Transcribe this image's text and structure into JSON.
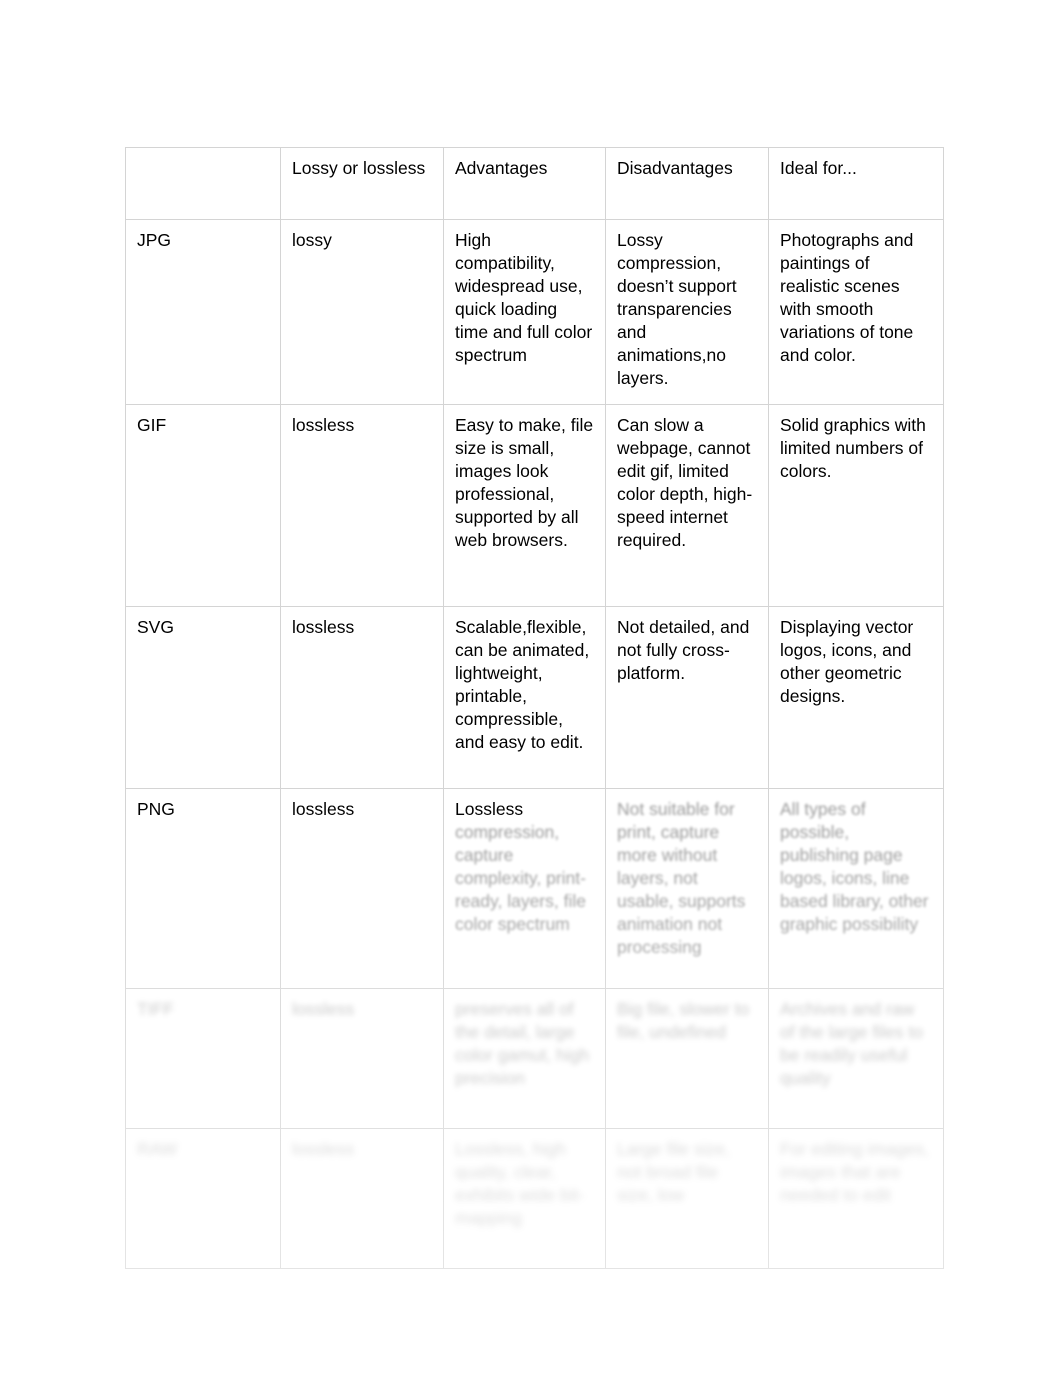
{
  "document": {
    "type": "comparison-table",
    "background_color": "#ffffff",
    "text_color": "#000000",
    "border_color": "#d4d4d4"
  },
  "table": {
    "columns": [
      {
        "key": "format",
        "header": ""
      },
      {
        "key": "lossy",
        "header": "Lossy or lossless"
      },
      {
        "key": "advantages",
        "header": "Advantages"
      },
      {
        "key": "disadvantages",
        "header": "Disadvantages"
      },
      {
        "key": "ideal",
        "header": "Ideal for..."
      }
    ],
    "rows": [
      {
        "legible": true,
        "blur": "none",
        "format": "JPG",
        "lossy": "lossy",
        "advantages": "High compatibility, widespread use, quick loading time and full color spectrum",
        "disadvantages": "Lossy compression, doesn’t support transparencies and animations,no layers.",
        "ideal": "Photographs and paintings of realistic scenes with smooth variations of tone and color."
      },
      {
        "legible": true,
        "blur": "none",
        "format": "GIF",
        "lossy": "lossless",
        "advantages": "Easy to make, file size is small, images look professional, supported by all web browsers.",
        "disadvantages": "Can slow a webpage, cannot edit gif, limited color depth, high-speed internet required.",
        "ideal": "Solid graphics with limited numbers of colors."
      },
      {
        "legible": true,
        "blur": "none",
        "format": "SVG",
        "lossy": "lossless",
        "advantages": "Scalable,flexible, can be animated, lightweight, printable, compressible, and easy to edit.",
        "disadvantages": "Not detailed, and not fully cross-platform.",
        "ideal": "Displaying vector logos, icons, and other geometric designs."
      },
      {
        "legible": "partial",
        "blur": "light",
        "format": "PNG",
        "lossy": "lossless",
        "advantages": "Lossless",
        "advantages_blurred": "compression, capture complexity, print-ready, layers, file color spectrum",
        "disadvantages_blurred": "Not suitable for print, capture more without layers, not usable, supports animation not processing",
        "ideal_blurred": "All types of possible, publishing page logos, icons, line based library, other graphic possibility"
      },
      {
        "legible": false,
        "blur": "mid",
        "format_blurred": "TIFF",
        "lossy_blurred": "lossless",
        "advantages_blurred": "preserves all of the detail, large color gamut, high precision",
        "disadvantages_blurred": "Big file, slower to file, undefined",
        "ideal_blurred": "Archives and raw of the large files to be readily useful quality"
      },
      {
        "legible": false,
        "blur": "heavy",
        "format_blurred": "RAW",
        "lossy_blurred": "lossless",
        "advantages_blurred": "Lossless, high quality, clear, exhibits wide bit-mapping",
        "disadvantages_blurred": "Large file size, not broad file size, low",
        "ideal_blurred": "For editing images, images that are needed to edit"
      }
    ]
  }
}
